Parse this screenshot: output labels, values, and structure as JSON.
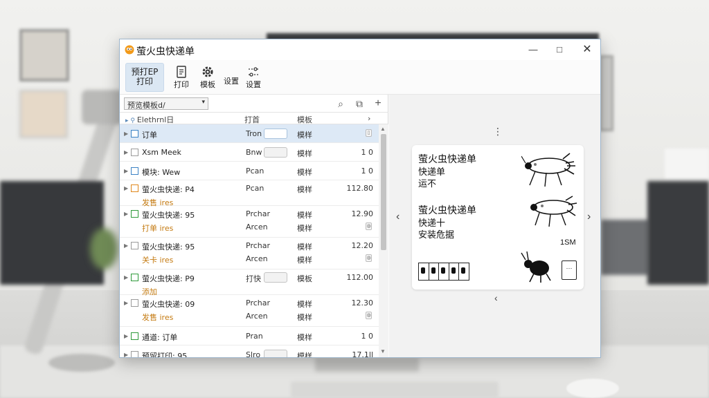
{
  "window": {
    "title": "萤火虫快递单",
    "controls": {
      "minimize": "—",
      "maximize": "□",
      "close": "✕"
    }
  },
  "toolbar": {
    "buttons": [
      {
        "label_top": "预打EP",
        "label": "打印",
        "icon": "print-ep-icon",
        "active": true
      },
      {
        "label": "打印",
        "icon": "document-icon"
      },
      {
        "label": "模板",
        "icon": "gear-icon"
      },
      {
        "label": "设置",
        "icon": ""
      },
      {
        "label": "设置",
        "icon": "settings-sliders-icon"
      }
    ]
  },
  "filter": {
    "select_value": "预览模板d/",
    "icons": {
      "search": "⌕",
      "grid": "⧉",
      "plus": "+"
    }
  },
  "columns": {
    "c1": "Elethrnl日",
    "c2": "打首",
    "c3": "模板",
    "c4": "›"
  },
  "rows": [
    {
      "line1": "订单",
      "c2a": "Tron",
      "c3a": "模样",
      "num": "",
      "checkbox_color": "#3b82c4",
      "selected": true,
      "toggle": true,
      "mini": "▯"
    },
    {
      "line1": "Xsm Meek",
      "c2a": "Bnw",
      "c3a": "模样",
      "num": "1 0",
      "checkbox_color": "#9a9a9a",
      "toggle": true
    },
    {
      "line1": "模块: Wew",
      "c2a": "Pcan",
      "c3a": "模样",
      "num": "1 0",
      "checkbox_color": "#3b82c4"
    },
    {
      "line1": "萤火虫快递: P4",
      "line2": "发售 ires",
      "c2a": "Pcan",
      "c3a": "模样",
      "num": "112.80",
      "checkbox_color": "#e0861a"
    },
    {
      "line1": "萤火虫快递: 95",
      "line2": "打单 ires",
      "c2a": "Prchar",
      "c2b": "Arcen",
      "c3a": "模样",
      "c3b": "模样",
      "num": "12.90",
      "checkbox_color": "#2e9a3a",
      "mini": "◍"
    },
    {
      "line1": "萤火虫快递: 95",
      "line2": "关卡 ires",
      "c2a": "Prchar",
      "c2b": "Arcen",
      "c3a": "模样",
      "c3b": "模样",
      "num": "12.20",
      "checkbox_color": "#9a9a9a",
      "mini": "◍"
    },
    {
      "line1": "萤火虫快递: P9",
      "line2": "添加",
      "c2a": "打快",
      "c3a": "模板",
      "num": "112.00",
      "checkbox_color": "#2e9a3a",
      "toggle": true
    },
    {
      "line1": "萤火虫快递: 09",
      "line2": "发售 ires",
      "c2a": "Prchar",
      "c2b": "Arcen",
      "c3a": "模样",
      "c3b": "模样",
      "num": "12.30",
      "checkbox_color": "#9a9a9a",
      "mini": "◍"
    },
    {
      "line1": "通道: 订单",
      "c2a": "Pran",
      "c3a": "模样",
      "num": "1 0",
      "checkbox_color": "#2e9a3a"
    },
    {
      "line1": "预留打印: 95",
      "c2a": "Slro",
      "c3a": "模样",
      "num": "17.1ll",
      "checkbox_color": "#9a9a9a",
      "toggle": true
    }
  ],
  "preview": {
    "block1": [
      "萤火虫快递单",
      "快递单",
      "运不"
    ],
    "block2": [
      "萤火虫快递单",
      "快递十",
      "安装危据"
    ],
    "size_label": "1SM",
    "nav": {
      "prev": "‹",
      "next": "›",
      "down": "‹",
      "more": "⋮"
    }
  }
}
